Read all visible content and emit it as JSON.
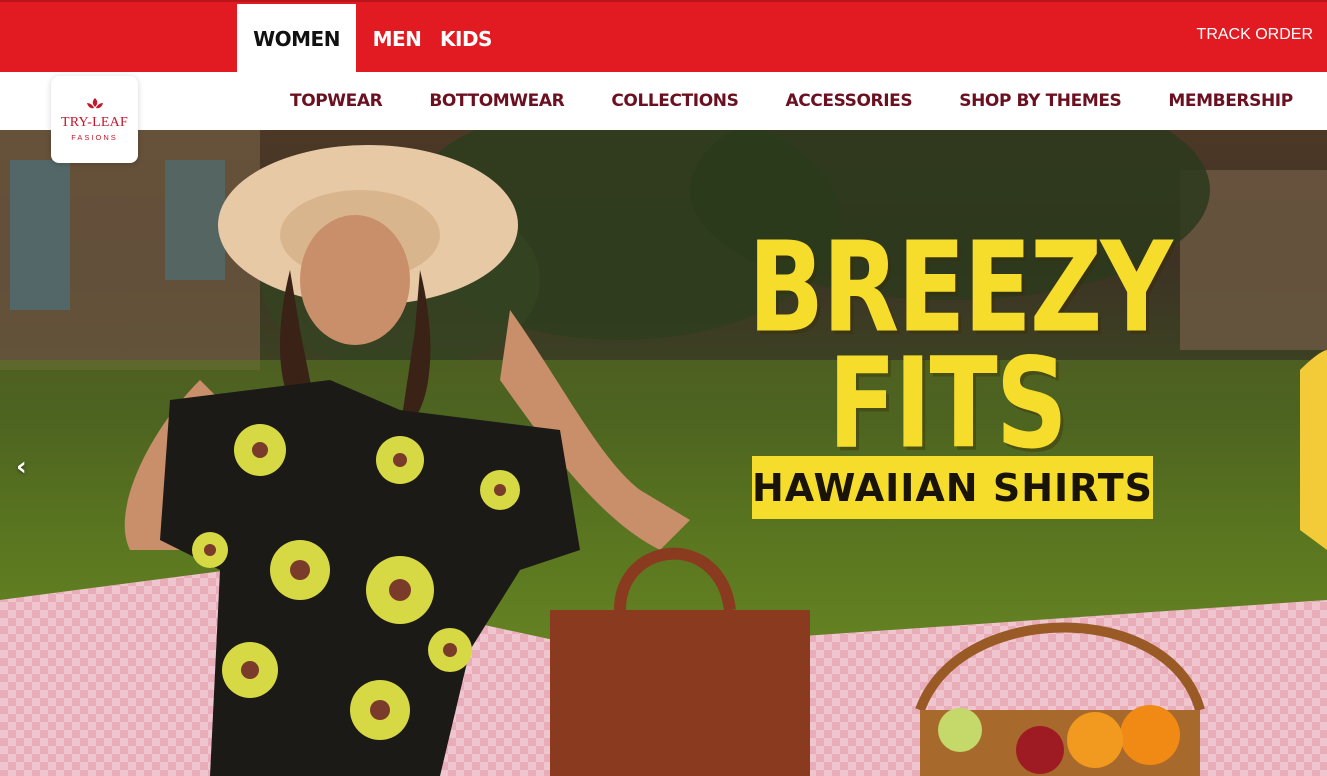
{
  "brand": {
    "name": "TRY-LEAF",
    "subtitle": "FASIONS",
    "color": "#c2182b"
  },
  "topbar": {
    "accent": "#e21b23",
    "tabs": [
      {
        "label": "WOMEN",
        "active": true
      },
      {
        "label": "MEN",
        "active": false
      },
      {
        "label": "KIDS",
        "active": false
      }
    ],
    "track_order": "TRACK ORDER"
  },
  "subnav": {
    "items": [
      {
        "label": "TOPWEAR"
      },
      {
        "label": "BOTTOMWEAR"
      },
      {
        "label": "COLLECTIONS"
      },
      {
        "label": "ACCESSORIES"
      },
      {
        "label": "SHOP BY THEMES"
      },
      {
        "label": "MEMBERSHIP"
      }
    ]
  },
  "hero": {
    "headline_line1": "BREEZY",
    "headline_line2": "FITS",
    "tagline": "HAWAIIAN SHIRTS",
    "prev_arrow": "‹",
    "accent": "#f6dd2c"
  }
}
